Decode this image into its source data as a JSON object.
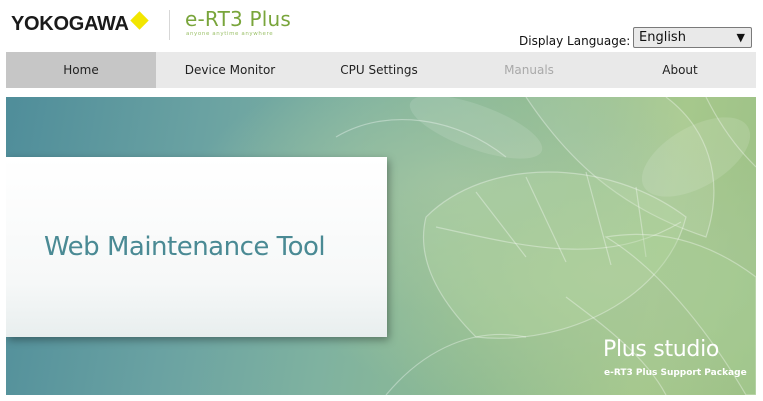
{
  "header": {
    "brand": "YOKOGAWA",
    "product": "e-RT3 Plus",
    "tagline": "anyone  anytime  anywhere",
    "language_label": "Display Language:",
    "language_value": "English"
  },
  "nav": {
    "items": [
      {
        "label": "Home",
        "state": "active"
      },
      {
        "label": "Device Monitor",
        "state": "normal"
      },
      {
        "label": "CPU Settings",
        "state": "normal"
      },
      {
        "label": "Manuals",
        "state": "disabled"
      },
      {
        "label": "About",
        "state": "normal"
      }
    ]
  },
  "banner": {
    "title": "Web Maintenance Tool",
    "plus_studio": "Plus studio",
    "plus_sub": "e-RT3 Plus Support Package"
  },
  "colors": {
    "brand_diamond": "#f2e600",
    "product_green": "#79a53b",
    "title_teal": "#4a8a94",
    "nav_bg": "#e9e9e9",
    "nav_active": "#c6c6c6"
  }
}
